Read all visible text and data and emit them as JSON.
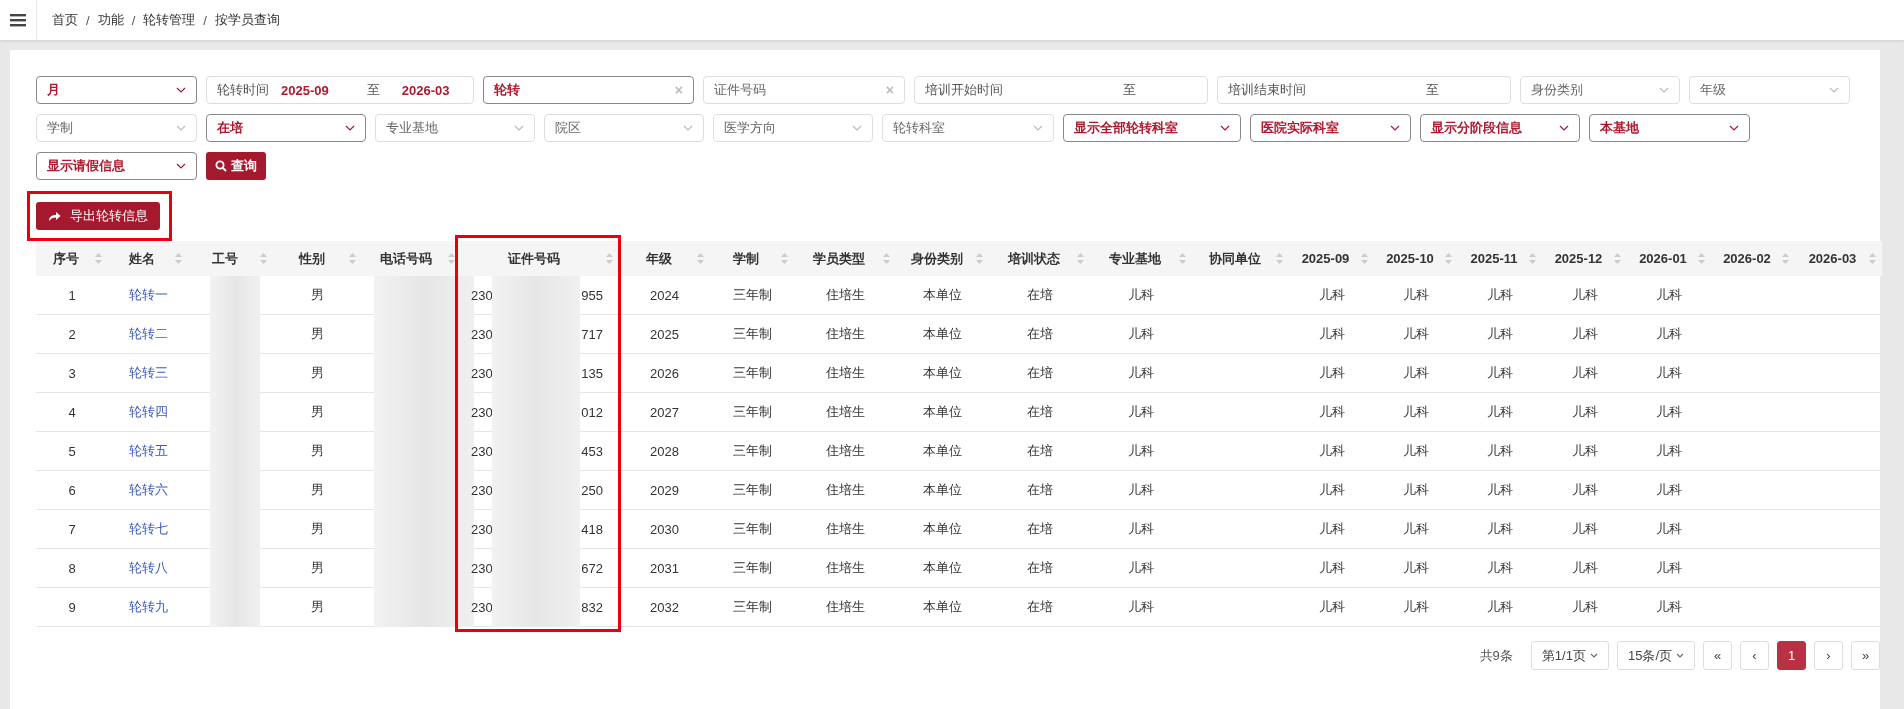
{
  "breadcrumb": {
    "separator": "/",
    "items": [
      "首页",
      "功能",
      "轮转管理",
      "按学员查询"
    ]
  },
  "filters": [
    {
      "kind": "select",
      "value": "月"
    },
    {
      "kind": "range",
      "label": "轮转时间",
      "from": "2025-09",
      "sep": "至",
      "to": "2026-03"
    },
    {
      "kind": "text",
      "value": "轮转",
      "clear": "×"
    },
    {
      "kind": "text",
      "placeholder": "证件号码",
      "clear": "×"
    },
    {
      "kind": "range",
      "label": "培训开始时间",
      "sep": "至"
    },
    {
      "kind": "range",
      "label": "培训结束时间",
      "sep": "至"
    },
    {
      "kind": "select",
      "placeholder": "身份类别"
    },
    {
      "kind": "select",
      "placeholder": "年级"
    },
    {
      "kind": "select",
      "placeholder": "学制"
    },
    {
      "kind": "select",
      "value": "在培"
    },
    {
      "kind": "select",
      "placeholder": "专业基地"
    },
    {
      "kind": "select",
      "placeholder": "院区"
    },
    {
      "kind": "select",
      "placeholder": "医学方向"
    },
    {
      "kind": "select",
      "placeholder": "轮转科室"
    },
    {
      "kind": "select",
      "value": "显示全部轮转科室"
    },
    {
      "kind": "select",
      "value": "医院实际科室"
    },
    {
      "kind": "select",
      "value": "显示分阶段信息"
    },
    {
      "kind": "select",
      "value": "本基地"
    },
    {
      "kind": "select",
      "value": "显示请假信息"
    },
    {
      "kind": "button",
      "label": "查询"
    }
  ],
  "export_button": {
    "label": "导出轮转信息",
    "highlight": true
  },
  "table": {
    "columns": [
      {
        "label": "序号",
        "kind": "text"
      },
      {
        "label": "姓名",
        "kind": "link"
      },
      {
        "label": "工号",
        "kind": "redacted"
      },
      {
        "label": "性别",
        "kind": "text"
      },
      {
        "label": "电话号码",
        "kind": "redacted"
      },
      {
        "label": "证件号码",
        "kind": "partial",
        "highlight": true
      },
      {
        "label": "年级",
        "kind": "text"
      },
      {
        "label": "学制",
        "kind": "text"
      },
      {
        "label": "学员类型",
        "kind": "text"
      },
      {
        "label": "身份类别",
        "kind": "text"
      },
      {
        "label": "培训状态",
        "kind": "text"
      },
      {
        "label": "专业基地",
        "kind": "text"
      },
      {
        "label": "协同单位",
        "kind": "text"
      },
      {
        "label": "2025-09",
        "kind": "month"
      },
      {
        "label": "2025-10",
        "kind": "month"
      },
      {
        "label": "2025-11",
        "kind": "month"
      },
      {
        "label": "2025-12",
        "kind": "month"
      },
      {
        "label": "2026-01",
        "kind": "month"
      },
      {
        "label": "2026-02",
        "kind": "month"
      },
      {
        "label": "2026-03",
        "kind": "month"
      }
    ],
    "rows": [
      {
        "index": "1",
        "name": "轮转一",
        "gender": "男",
        "id_start": "230",
        "id_end": "955",
        "grade": "2024",
        "system": "三年制",
        "type": "住培生",
        "identity": "本单位",
        "status": "在培",
        "base": "儿科",
        "months": [
          "儿科",
          "儿科",
          "儿科",
          "儿科",
          "儿科"
        ]
      },
      {
        "index": "2",
        "name": "轮转二",
        "gender": "男",
        "id_start": "230",
        "id_end": "717",
        "grade": "2025",
        "system": "三年制",
        "type": "住培生",
        "identity": "本单位",
        "status": "在培",
        "base": "儿科",
        "months": [
          "儿科",
          "儿科",
          "儿科",
          "儿科",
          "儿科"
        ]
      },
      {
        "index": "3",
        "name": "轮转三",
        "gender": "男",
        "id_start": "230",
        "id_end": "135",
        "grade": "2026",
        "system": "三年制",
        "type": "住培生",
        "identity": "本单位",
        "status": "在培",
        "base": "儿科",
        "months": [
          "儿科",
          "儿科",
          "儿科",
          "儿科",
          "儿科"
        ]
      },
      {
        "index": "4",
        "name": "轮转四",
        "gender": "男",
        "id_start": "230",
        "id_end": "012",
        "grade": "2027",
        "system": "三年制",
        "type": "住培生",
        "identity": "本单位",
        "status": "在培",
        "base": "儿科",
        "months": [
          "儿科",
          "儿科",
          "儿科",
          "儿科",
          "儿科"
        ]
      },
      {
        "index": "5",
        "name": "轮转五",
        "gender": "男",
        "id_start": "230",
        "id_end": "453",
        "grade": "2028",
        "system": "三年制",
        "type": "住培生",
        "identity": "本单位",
        "status": "在培",
        "base": "儿科",
        "months": [
          "儿科",
          "儿科",
          "儿科",
          "儿科",
          "儿科"
        ]
      },
      {
        "index": "6",
        "name": "轮转六",
        "gender": "男",
        "id_start": "230",
        "id_end": "250",
        "grade": "2029",
        "system": "三年制",
        "type": "住培生",
        "identity": "本单位",
        "status": "在培",
        "base": "儿科",
        "months": [
          "儿科",
          "儿科",
          "儿科",
          "儿科",
          "儿科"
        ]
      },
      {
        "index": "7",
        "name": "轮转七",
        "gender": "男",
        "id_start": "230",
        "id_end": "418",
        "grade": "2030",
        "system": "三年制",
        "type": "住培生",
        "identity": "本单位",
        "status": "在培",
        "base": "儿科",
        "months": [
          "儿科",
          "儿科",
          "儿科",
          "儿科",
          "儿科"
        ]
      },
      {
        "index": "8",
        "name": "轮转八",
        "gender": "男",
        "id_start": "230",
        "id_end": "672",
        "grade": "2031",
        "system": "三年制",
        "type": "住培生",
        "identity": "本单位",
        "status": "在培",
        "base": "儿科",
        "months": [
          "儿科",
          "儿科",
          "儿科",
          "儿科",
          "儿科"
        ]
      },
      {
        "index": "9",
        "name": "轮转九",
        "gender": "男",
        "id_start": "230",
        "id_end": "832",
        "grade": "2032",
        "system": "三年制",
        "type": "住培生",
        "identity": "本单位",
        "status": "在培",
        "base": "儿科",
        "months": [
          "儿科",
          "儿科",
          "儿科",
          "儿科",
          "儿科"
        ]
      }
    ]
  },
  "pagination": {
    "total": "共9条",
    "page_select": "第1/1页",
    "size_select": "15条/页",
    "first": "«",
    "prev": "‹",
    "pages": [
      {
        "label": "1",
        "selected": true
      }
    ],
    "next": "›",
    "last": "»"
  }
}
